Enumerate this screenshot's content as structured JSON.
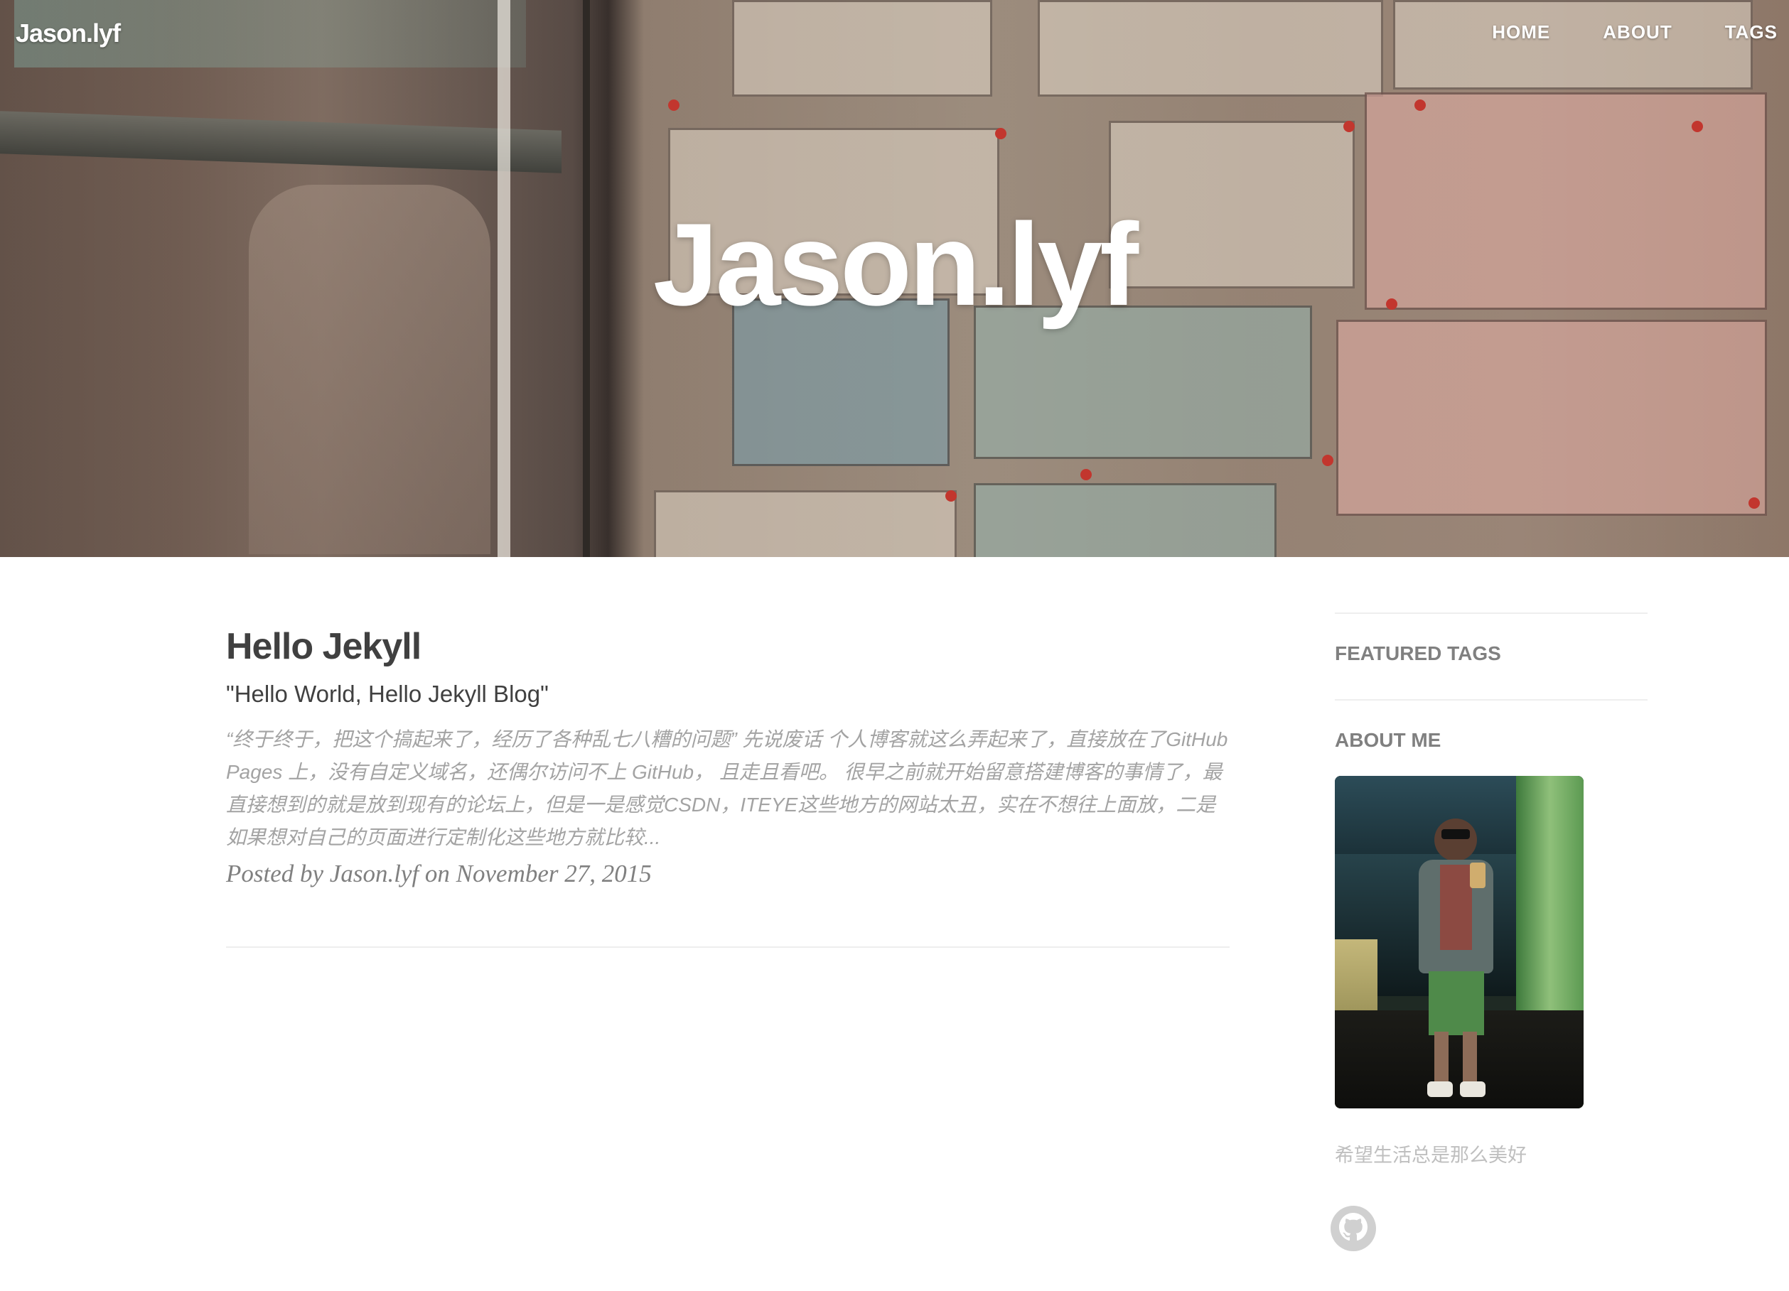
{
  "nav": {
    "brand": "Jason.lyf",
    "links": [
      "HOME",
      "ABOUT",
      "TAGS"
    ]
  },
  "hero": {
    "title": "Jason.lyf"
  },
  "post": {
    "title": "Hello Jekyll",
    "subtitle": "\"Hello World, Hello Jekyll Blog\"",
    "excerpt": "“终于终于，把这个搞起来了，经历了各种乱七八糟的问题” 先说废话 个人博客就这么弄起来了，直接放在了GitHub Pages 上，没有自定义域名，还偶尔访问不上 GitHub， 且走且看吧。 很早之前就开始留意搭建博客的事情了，最直接想到的就是放到现有的论坛上，但是一是感觉CSDN，ITEYE这些地方的网站太丑，实在不想往上面放，二是如果想对自己的页面进行定制化这些地方就比较...",
    "meta": "Posted by Jason.lyf on November 27, 2015"
  },
  "sidebar": {
    "featured_tags_heading": "FEATURED TAGS",
    "about_heading": "ABOUT ME",
    "about_text": "希望生活总是那么美好",
    "social": [
      {
        "icon": "github-icon"
      }
    ]
  },
  "colors": {
    "text_dark": "#404040",
    "text_muted": "#a3a3a3",
    "heading_muted": "#808080",
    "divider": "#eeeeee"
  }
}
